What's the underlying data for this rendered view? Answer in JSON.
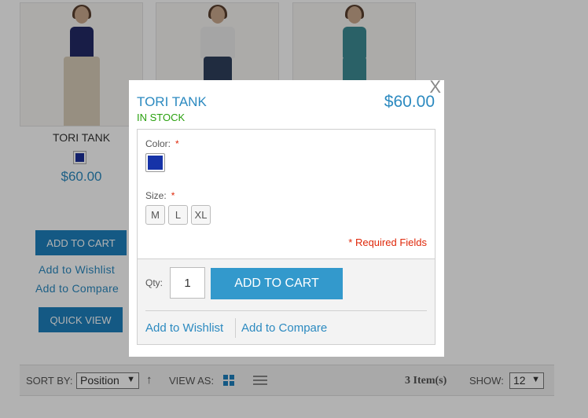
{
  "product_grid": {
    "first_item": {
      "name": "TORI TANK",
      "price": "$60.00",
      "swatch_color": "#1b2f9a",
      "add_to_cart_label": "ADD TO CART",
      "add_to_wishlist_label": "Add to Wishlist",
      "add_to_compare_label": "Add to Compare",
      "quick_view_label": "QUICK VIEW"
    }
  },
  "toolbar": {
    "sort_by_label": "SORT BY:",
    "sort_value": "Position",
    "sort_direction_icon": "up-arrow",
    "view_as_label": "VIEW AS:",
    "item_count": "3 Item(s)",
    "show_label": "SHOW:",
    "show_value": "12",
    "accent_color": "#1d80bd"
  },
  "quick_view": {
    "close_label": "X",
    "title": "TORI TANK",
    "stock_status": "IN STOCK",
    "price": "$60.00",
    "color_label": "Color:",
    "size_label": "Size:",
    "required_star": "*",
    "selected_color": "#1633a8",
    "sizes": [
      "M",
      "L",
      "XL"
    ],
    "required_fields": "* Required Fields",
    "qty_label": "Qty:",
    "qty_value": "1",
    "add_to_cart_label": "ADD TO CART",
    "add_to_wishlist_label": "Add to Wishlist",
    "add_to_compare_label": "Add to Compare"
  }
}
